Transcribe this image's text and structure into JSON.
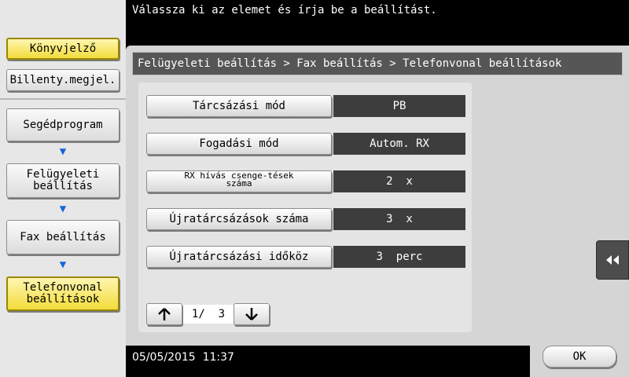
{
  "message": "Válassza ki az elemet és írja be a beállítást.",
  "sidebar": {
    "top_buttons": [
      {
        "label": "Könyvjelző",
        "active": true
      },
      {
        "label": "Billenty.megjel.",
        "active": false
      }
    ],
    "nav": [
      {
        "label": "Segédprogram"
      },
      {
        "label": "Felügyeleti beállítás"
      },
      {
        "label": "Fax beállítás"
      },
      {
        "label": "Telefonvonal beállítások"
      }
    ]
  },
  "breadcrumb": "Felügyeleti beállítás > Fax beállítás > Telefonvonal beállítások",
  "settings": [
    {
      "label": "Tárcsázási mód",
      "value": "PB"
    },
    {
      "label": "Fogadási mód",
      "value": "Autom. RX"
    },
    {
      "label": "RX hívás csenge-tések száma",
      "value": "2  x"
    },
    {
      "label": "Újratárcsázások száma",
      "value": "3  x"
    },
    {
      "label": "Újratárcsázási időköz",
      "value": "3  perc"
    }
  ],
  "pager": {
    "text": "1/  3",
    "up_icon": "arrow-up-icon",
    "down_icon": "arrow-down-icon"
  },
  "datetime": "05/05/2015  11:37",
  "ok_label": "OK",
  "colors": {
    "highlight": "#f2dc3c",
    "value_bg": "#3d3d3d",
    "arrow": "#1565d8"
  }
}
